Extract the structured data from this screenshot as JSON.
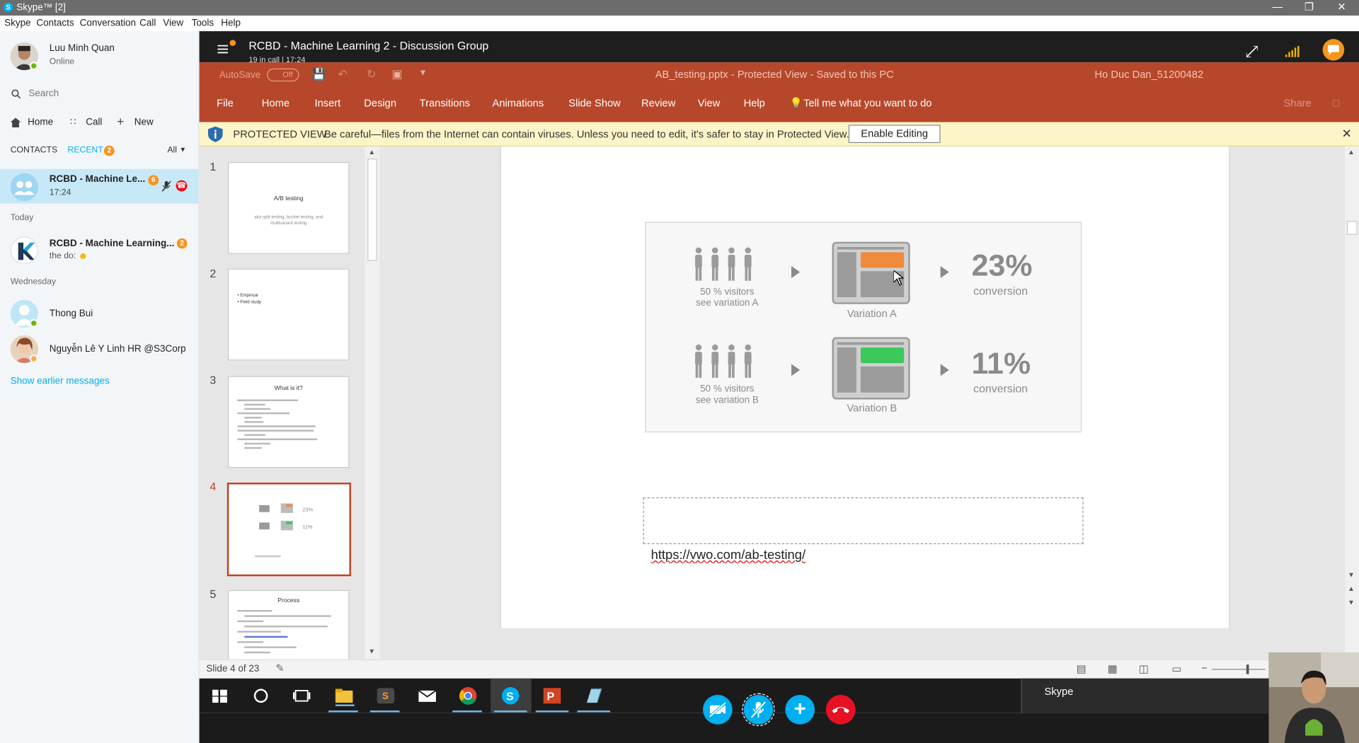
{
  "window": {
    "title": "Skype™ [2]"
  },
  "menu": [
    "Skype",
    "Contacts",
    "Conversation",
    "Call",
    "View",
    "Tools",
    "Help"
  ],
  "profile": {
    "name": "Luu Minh Quan",
    "status": "Online"
  },
  "search": {
    "placeholder": "Search"
  },
  "nav": {
    "home": "Home",
    "call": "Call",
    "new": "New"
  },
  "tabs": {
    "contacts": "CONTACTS",
    "recent": "RECENT",
    "recent_badge": "2",
    "filter": "All"
  },
  "active_conversation": {
    "name": "RCBD - Machine Le...",
    "time": "17:24",
    "badge": "6"
  },
  "sections": {
    "today": "Today",
    "wednesday": "Wednesday"
  },
  "conversations": [
    {
      "name": "RCBD - Machine Learning...",
      "preview": "the do:",
      "badge": "2"
    },
    {
      "name": "Thong Bui"
    },
    {
      "name": "Nguyễn Lê Y Linh HR @S3Corp"
    }
  ],
  "show_earlier": "Show earlier messages",
  "call": {
    "title": "RCBD - Machine Learning 2 - Discussion Group",
    "status": "19 in call | 17:24"
  },
  "ppt": {
    "autosave": "AutoSave",
    "autosave_state": "Off",
    "file_title": "AB_testing.pptx  -  Protected View  -  Saved to this PC",
    "user": "Ho Duc Dan_51200482",
    "ribbon": [
      "File",
      "Home",
      "Insert",
      "Design",
      "Transitions",
      "Animations",
      "Slide Show",
      "Review",
      "View",
      "Help"
    ],
    "tell_me": "Tell me what you want to do",
    "share": "Share"
  },
  "protected": {
    "label": "PROTECTED VIEW",
    "message": "Be careful—files from the Internet can contain viruses. Unless you need to edit, it's safer to stay in Protected View.",
    "button": "Enable Editing"
  },
  "thumbnails": [
    {
      "num": "1",
      "title": "A/B testing",
      "subtitle": "aka split testing, bucket testing, and multivariant testing"
    },
    {
      "num": "2",
      "bullets": [
        "Empirical",
        "Field study"
      ]
    },
    {
      "num": "3",
      "title": "What is it?"
    },
    {
      "num": "4"
    },
    {
      "num": "5",
      "title": "Process"
    }
  ],
  "slide": {
    "row_a": {
      "visitors": "50 % visitors",
      "see": "see variation A",
      "variation": "Variation A",
      "pct": "23%",
      "conv": "conversion"
    },
    "row_b": {
      "visitors": "50 % visitors",
      "see": "see variation B",
      "variation": "Variation B",
      "pct": "11%",
      "conv": "conversion"
    },
    "link": "https://vwo.com/ab-testing/"
  },
  "status": {
    "slide": "Slide 4 of 23"
  },
  "taskbar": {
    "skype_label": "Skype"
  },
  "colors": {
    "skype_blue": "#00aff0",
    "ppt_red": "#b7472a",
    "accent_orange": "#f7941d",
    "online_green": "#6bb700",
    "end_call_red": "#e81123"
  }
}
